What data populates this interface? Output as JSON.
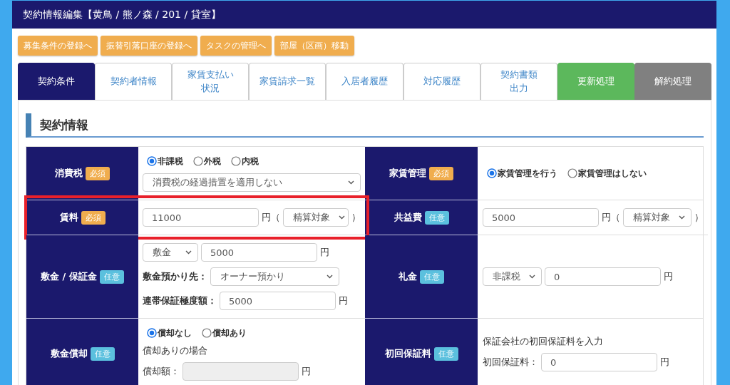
{
  "window": {
    "title": "契約情報編集【黄鳥 / 熊ノ森 / 201 / 貸室】"
  },
  "action_buttons": [
    {
      "label": "募集条件の登録へ"
    },
    {
      "label": "振替引落口座の登録へ"
    },
    {
      "label": "タスクの管理へ"
    },
    {
      "label": "部屋（区画）移動"
    }
  ],
  "tabs": [
    {
      "lines": [
        "契約条件"
      ],
      "selected": true,
      "kind": "plain"
    },
    {
      "lines": [
        "契約者情報"
      ],
      "selected": false,
      "kind": "plain"
    },
    {
      "lines": [
        "家賃支払い",
        "状況"
      ],
      "selected": false,
      "kind": "plain"
    },
    {
      "lines": [
        "家賃請求一覧"
      ],
      "selected": false,
      "kind": "plain"
    },
    {
      "lines": [
        "入居者履歴"
      ],
      "selected": false,
      "kind": "plain"
    },
    {
      "lines": [
        "対応履歴"
      ],
      "selected": false,
      "kind": "plain"
    },
    {
      "lines": [
        "契約書類",
        "出力"
      ],
      "selected": false,
      "kind": "plain"
    },
    {
      "lines": [
        "更新処理"
      ],
      "selected": false,
      "kind": "success"
    },
    {
      "lines": [
        "解約処理"
      ],
      "selected": false,
      "kind": "muted"
    }
  ],
  "section": {
    "title": "契約情報"
  },
  "form_rows": [
    {
      "cells": [
        {
          "label": "消費税",
          "badge": {
            "text": "必須",
            "kind": "required"
          },
          "highlighted": false,
          "lines": [
            [
              {
                "kind": "radio",
                "label": "非課税",
                "selected": true
              },
              {
                "kind": "radio",
                "label": "外税",
                "selected": false
              },
              {
                "kind": "radio",
                "label": "内税",
                "selected": false
              }
            ],
            [
              {
                "kind": "select",
                "value": "消費税の経過措置を適用しない"
              }
            ]
          ]
        },
        {
          "label": "家賃管理",
          "badge": {
            "text": "必須",
            "kind": "required"
          },
          "highlighted": false,
          "lines": [
            [
              {
                "kind": "radio",
                "label": "家賃管理を行う",
                "selected": true
              },
              {
                "kind": "radio",
                "label": "家賃管理はしない",
                "selected": false
              }
            ]
          ]
        }
      ]
    },
    {
      "cells": [
        {
          "label": "賃料",
          "badge": {
            "text": "必須",
            "kind": "required"
          },
          "highlighted": true,
          "lines": [
            [
              {
                "kind": "input",
                "value": "11000",
                "disabled": false
              },
              {
                "kind": "unit",
                "text": "円（"
              },
              {
                "kind": "select",
                "value": "精算対象"
              },
              {
                "kind": "unit",
                "text": "）"
              }
            ]
          ]
        },
        {
          "label": "共益費",
          "badge": {
            "text": "任意",
            "kind": "optional"
          },
          "highlighted": false,
          "lines": [
            [
              {
                "kind": "input",
                "value": "5000",
                "disabled": false
              },
              {
                "kind": "unit",
                "text": "円（"
              },
              {
                "kind": "select",
                "value": "精算対象"
              },
              {
                "kind": "unit",
                "text": "）"
              }
            ]
          ]
        }
      ]
    },
    {
      "cells": [
        {
          "label": "敷金 / 保証金",
          "badge": {
            "text": "任意",
            "kind": "optional"
          },
          "highlighted": false,
          "lines": [
            [
              {
                "kind": "select",
                "value": "敷金"
              },
              {
                "kind": "input",
                "value": "5000",
                "disabled": false
              },
              {
                "kind": "unit",
                "text": "円"
              }
            ],
            [
              {
                "kind": "label",
                "text": "敷金預かり先："
              },
              {
                "kind": "select",
                "value": "オーナー預かり"
              }
            ],
            [
              {
                "kind": "label",
                "text": "連帯保証極度額："
              },
              {
                "kind": "input",
                "value": "5000",
                "disabled": false
              },
              {
                "kind": "unit",
                "text": "円"
              }
            ]
          ]
        },
        {
          "label": "礼金",
          "badge": {
            "text": "任意",
            "kind": "optional"
          },
          "highlighted": false,
          "lines": [
            [
              {
                "kind": "select",
                "value": "非課税"
              },
              {
                "kind": "input",
                "value": "0",
                "disabled": false
              },
              {
                "kind": "unit",
                "text": "円"
              }
            ]
          ]
        }
      ]
    },
    {
      "cells": [
        {
          "label": "敷金償却",
          "badge": {
            "text": "任意",
            "kind": "optional"
          },
          "highlighted": false,
          "lines": [
            [
              {
                "kind": "radio",
                "label": "償却なし",
                "selected": true
              },
              {
                "kind": "radio",
                "label": "償却あり",
                "selected": false
              }
            ],
            [
              {
                "kind": "note",
                "text": "償却ありの場合"
              }
            ],
            [
              {
                "kind": "note",
                "text": "償却額："
              },
              {
                "kind": "input",
                "disabled": true
              },
              {
                "kind": "unit",
                "text": "円"
              }
            ]
          ]
        },
        {
          "label": "初回保証料",
          "badge": {
            "text": "任意",
            "kind": "optional"
          },
          "highlighted": false,
          "lines": [
            [
              {
                "kind": "note",
                "text": "保証会社の初回保証料を入力"
              }
            ],
            [
              {
                "kind": "note",
                "text": "初回保証料："
              },
              {
                "kind": "input",
                "value": "0",
                "disabled": false
              },
              {
                "kind": "unit",
                "text": "円"
              }
            ]
          ]
        }
      ]
    }
  ]
}
